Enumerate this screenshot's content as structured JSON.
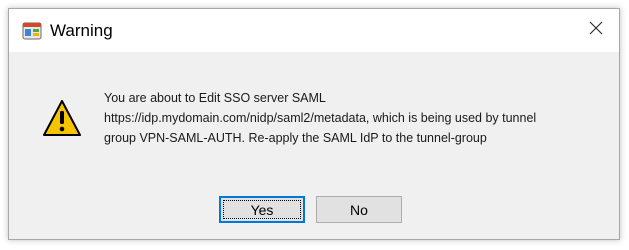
{
  "window": {
    "title": "Warning",
    "app_icon": "app-window-icon",
    "close_icon": "close-icon"
  },
  "message": {
    "icon": "warning-icon",
    "lines": [
      "You are about to Edit SSO server SAML",
      "https://idp.mydomain.com/nidp/saml2/metadata, which is being used by tunnel",
      "group VPN-SAML-AUTH. Re-apply the SAML IdP to the tunnel-group"
    ]
  },
  "buttons": {
    "yes_label": "Yes",
    "no_label": "No"
  },
  "colors": {
    "dialog_bg": "#f0f0f0",
    "titlebar_bg": "#ffffff",
    "focus_border": "#0078d7",
    "warning_yellow": "#f5c400"
  }
}
